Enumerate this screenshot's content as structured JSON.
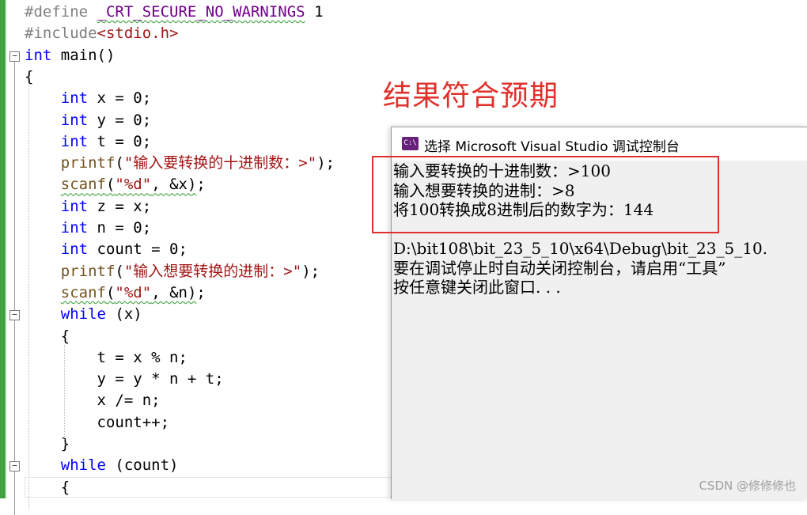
{
  "editor": {
    "lines": [
      {
        "segments": [
          {
            "t": "#define ",
            "c": "pp"
          },
          {
            "t": "_CRT_SECURE_NO_WARNINGS",
            "c": "kwm"
          },
          {
            "t": " 1",
            "c": ""
          }
        ]
      },
      {
        "segments": [
          {
            "t": "#include",
            "c": "pp"
          },
          {
            "t": "<stdio.h>",
            "c": "str"
          }
        ]
      },
      {
        "segments": [
          {
            "t": "int",
            "c": "kw"
          },
          {
            "t": " main()",
            "c": ""
          }
        ]
      },
      {
        "segments": [
          {
            "t": "{",
            "c": ""
          }
        ]
      },
      {
        "segments": [
          {
            "t": "    ",
            "c": ""
          },
          {
            "t": "int",
            "c": "kw"
          },
          {
            "t": " x = 0;",
            "c": ""
          }
        ]
      },
      {
        "segments": [
          {
            "t": "    ",
            "c": ""
          },
          {
            "t": "int",
            "c": "kw"
          },
          {
            "t": " y = 0;",
            "c": ""
          }
        ]
      },
      {
        "segments": [
          {
            "t": "    ",
            "c": ""
          },
          {
            "t": "int",
            "c": "kw"
          },
          {
            "t": " t = 0;",
            "c": ""
          }
        ]
      },
      {
        "segments": [
          {
            "t": "    ",
            "c": ""
          },
          {
            "t": "printf",
            "c": "fn"
          },
          {
            "t": "(",
            "c": ""
          },
          {
            "t": "\"输入要转换的十进制数：>\"",
            "c": "str"
          },
          {
            "t": ");",
            "c": ""
          }
        ]
      },
      {
        "segments": [
          {
            "t": "    ",
            "c": ""
          },
          {
            "t": "scanf",
            "c": "fn sq"
          },
          {
            "t": "(",
            "c": "sq"
          },
          {
            "t": "\"%d\"",
            "c": "str sq"
          },
          {
            "t": ", &x)",
            "c": "sq"
          },
          {
            "t": ";",
            "c": ""
          }
        ]
      },
      {
        "segments": [
          {
            "t": "    ",
            "c": ""
          },
          {
            "t": "int",
            "c": "kw"
          },
          {
            "t": " z = x;",
            "c": ""
          }
        ]
      },
      {
        "segments": [
          {
            "t": "    ",
            "c": ""
          },
          {
            "t": "int",
            "c": "kw"
          },
          {
            "t": " n = 0;",
            "c": ""
          }
        ]
      },
      {
        "segments": [
          {
            "t": "    ",
            "c": ""
          },
          {
            "t": "int",
            "c": "kw"
          },
          {
            "t": " count = 0;",
            "c": ""
          }
        ]
      },
      {
        "segments": [
          {
            "t": "    ",
            "c": ""
          },
          {
            "t": "printf",
            "c": "fn"
          },
          {
            "t": "(",
            "c": ""
          },
          {
            "t": "\"输入想要转换的进制：>\"",
            "c": "str"
          },
          {
            "t": ");",
            "c": ""
          }
        ]
      },
      {
        "segments": [
          {
            "t": "    ",
            "c": ""
          },
          {
            "t": "scanf",
            "c": "fn sq"
          },
          {
            "t": "(",
            "c": "sq"
          },
          {
            "t": "\"%d\"",
            "c": "str sq"
          },
          {
            "t": ", &n)",
            "c": "sq"
          },
          {
            "t": ";",
            "c": ""
          }
        ]
      },
      {
        "segments": [
          {
            "t": "    ",
            "c": ""
          },
          {
            "t": "while",
            "c": "kw"
          },
          {
            "t": " (x)",
            "c": ""
          }
        ]
      },
      {
        "segments": [
          {
            "t": "    {",
            "c": ""
          }
        ]
      },
      {
        "segments": [
          {
            "t": "        t = x % n;",
            "c": ""
          }
        ]
      },
      {
        "segments": [
          {
            "t": "        y = y * n + t;",
            "c": ""
          }
        ]
      },
      {
        "segments": [
          {
            "t": "        x /= n;",
            "c": ""
          }
        ]
      },
      {
        "segments": [
          {
            "t": "        count++;",
            "c": ""
          }
        ]
      },
      {
        "segments": [
          {
            "t": "    }",
            "c": ""
          }
        ]
      },
      {
        "segments": [
          {
            "t": "    ",
            "c": ""
          },
          {
            "t": "while",
            "c": "kw"
          },
          {
            "t": " (count)",
            "c": ""
          }
        ]
      },
      {
        "segments": [
          {
            "t": "    {",
            "c": ""
          }
        ]
      }
    ]
  },
  "annotation": {
    "result_label": "结果符合预期"
  },
  "console": {
    "title": "选择 Microsoft Visual Studio 调试控制台",
    "icon_text": "C:\\",
    "output": [
      "输入要转换的十进制数：>100",
      "输入想要转换的进制：>8",
      "将100转换成8进制后的数字为：144",
      "",
      "D:\\bit108\\bit_23_5_10\\x64\\Debug\\bit_23_5_10.",
      "要在调试停止时自动关闭控制台，请启用“工具”",
      "按任意键关闭此窗口. . ."
    ]
  },
  "watermark": "CSDN @修修修也",
  "colors": {
    "keyword": "#0000ff",
    "preprocessor": "#808080",
    "function": "#74531f",
    "string": "#a31515",
    "annotation": "#e0302b",
    "change_bar": "#3fa33f"
  },
  "icons": [
    "fold-collapse-icon",
    "visual-studio-console-icon"
  ]
}
